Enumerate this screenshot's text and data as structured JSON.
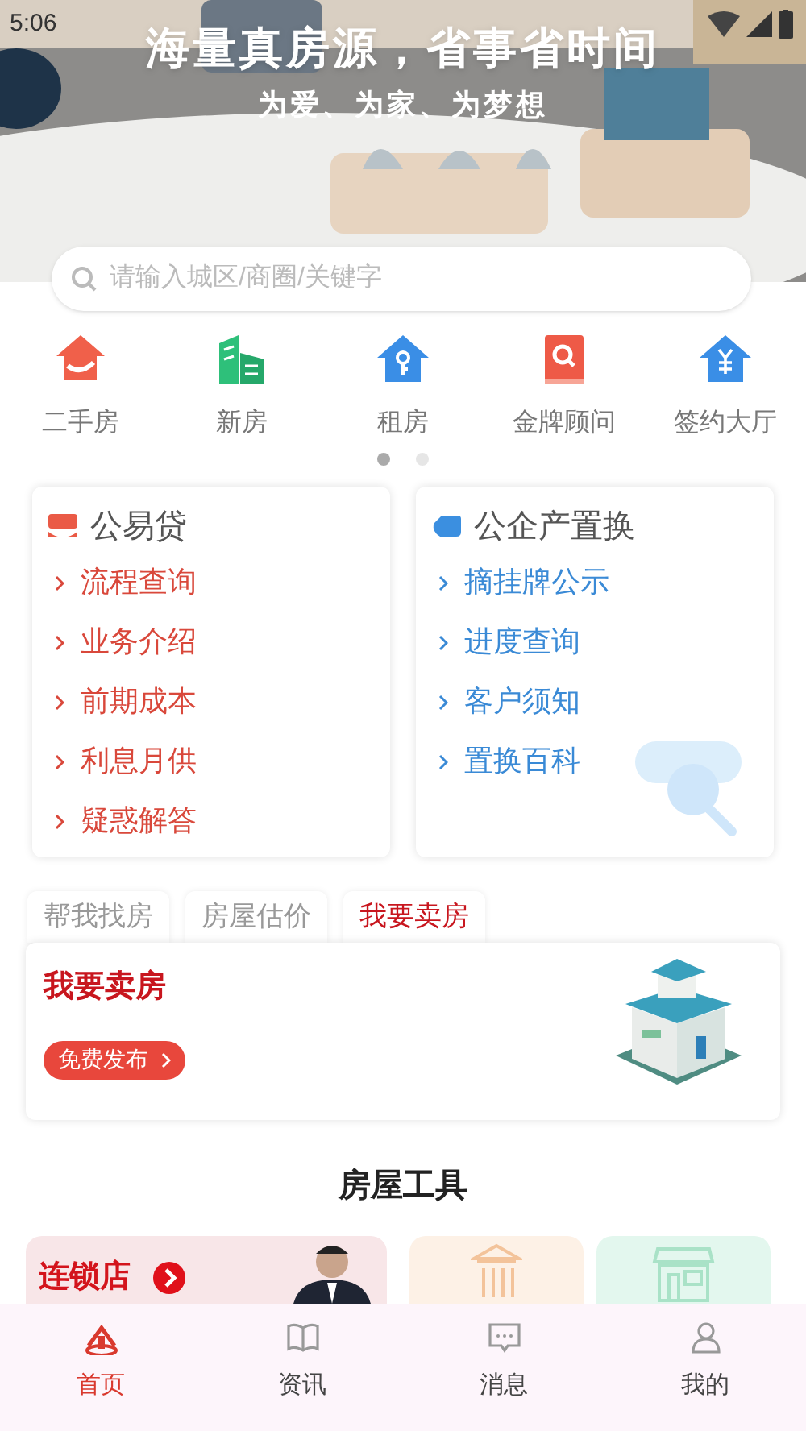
{
  "status_bar": {
    "time": "5:06"
  },
  "hero": {
    "kind": "picture",
    "title": "海量真房源，省事省时间",
    "subtitle": "为爱、为家、为梦想"
  },
  "search": {
    "placeholder": "请输入城区/商圈/关键字"
  },
  "categories": [
    {
      "label": "二手房",
      "kind": "resale"
    },
    {
      "label": "新房",
      "kind": "new"
    },
    {
      "label": "租房",
      "kind": "rent"
    },
    {
      "label": "金牌顾问",
      "kind": "advisor"
    },
    {
      "label": "签约大厅",
      "kind": "sign"
    }
  ],
  "pager": [
    {
      "selected": true
    },
    {
      "selected": false
    }
  ],
  "panels": [
    {
      "title": "公易贷",
      "kind": "loan",
      "links": [
        "流程查询",
        "业务介绍",
        "前期成本",
        "利息月供",
        "疑惑解答"
      ]
    },
    {
      "title": "公企产置换",
      "kind": "swap",
      "links": [
        "摘挂牌公示",
        "进度查询",
        "客户须知",
        "置换百科"
      ]
    }
  ],
  "service_tabs": [
    {
      "label": "帮我找房",
      "selected": false
    },
    {
      "label": "房屋估价",
      "selected": false
    },
    {
      "label": "我要卖房",
      "selected": true
    }
  ],
  "service_panel": {
    "title": "我要卖房",
    "button": "免费发布"
  },
  "tools": {
    "title": "房屋工具",
    "cards": [
      {
        "kind": "chain",
        "label": "连锁店"
      },
      {
        "kind": "office"
      },
      {
        "kind": "hotline"
      }
    ]
  },
  "tab_bar": [
    {
      "label": "首页",
      "kind": "home",
      "selected": true
    },
    {
      "label": "资讯",
      "kind": "news",
      "selected": false
    },
    {
      "label": "消息",
      "kind": "message",
      "selected": false
    },
    {
      "label": "我的",
      "kind": "me",
      "selected": false
    }
  ]
}
